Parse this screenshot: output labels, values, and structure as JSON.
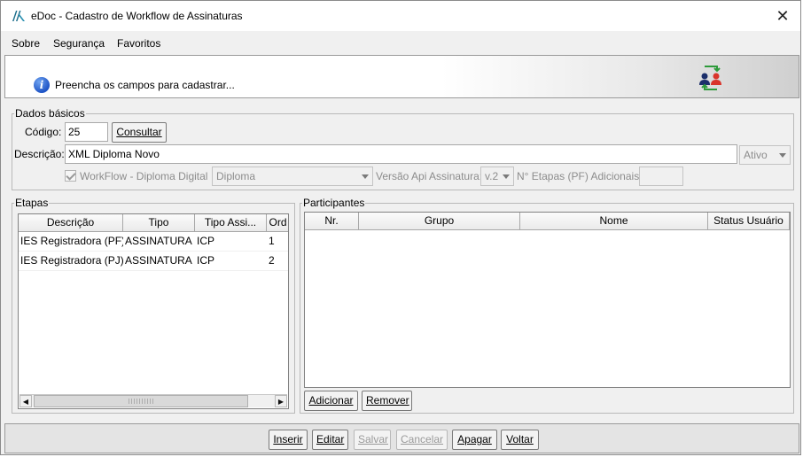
{
  "window": {
    "title": "eDoc - Cadastro de Workflow de Assinaturas",
    "close_glyph": "✕"
  },
  "menu": [
    "Sobre",
    "Segurança",
    "Favoritos"
  ],
  "header": {
    "message": "Preencha os campos para cadastrar...",
    "icon": "info-icon",
    "logo_icon": "users-sync-icon"
  },
  "dados_basicos": {
    "legend": "Dados básicos",
    "codigo_label": "Código:",
    "codigo_value": "25",
    "consultar_label": "Consultar",
    "descricao_label": "Descrição:",
    "descricao_value": "XML Diploma Novo",
    "status_value": "Ativo",
    "workflow_check_label": "WorkFlow - Diploma Digital",
    "workflow_checked": true,
    "tipo_value": "Diploma",
    "versao_label": "Versão Api Assinatura:",
    "versao_value": "v.2",
    "etapas_label": "N° Etapas (PF) Adicionais:",
    "etapas_value": ""
  },
  "etapas": {
    "legend": "Etapas",
    "columns": [
      "Descrição",
      "Tipo",
      "Tipo Assi...",
      "Ord"
    ],
    "rows": [
      [
        "IES Registradora (PF)",
        "ASSINATURA",
        "ICP",
        "1"
      ],
      [
        "IES Registradora (PJ)",
        "ASSINATURA",
        "ICP",
        "2"
      ]
    ]
  },
  "participantes": {
    "legend": "Participantes",
    "columns": [
      "Nr.",
      "Grupo",
      "Nome",
      "Status Usuário"
    ],
    "rows": [],
    "adicionar_label": "Adicionar",
    "remover_label": "Remover"
  },
  "footer": {
    "buttons": [
      {
        "label": "Inserir",
        "enabled": true
      },
      {
        "label": "Editar",
        "enabled": true
      },
      {
        "label": "Salvar",
        "enabled": false
      },
      {
        "label": "Cancelar",
        "enabled": false
      },
      {
        "label": "Apagar",
        "enabled": true
      },
      {
        "label": "Voltar",
        "enabled": true
      }
    ]
  },
  "colors": {
    "info_blue": "#1f55c6",
    "logo_green": "#2e9b3b",
    "logo_red": "#d9342b",
    "logo_navy": "#1c2f6b"
  }
}
